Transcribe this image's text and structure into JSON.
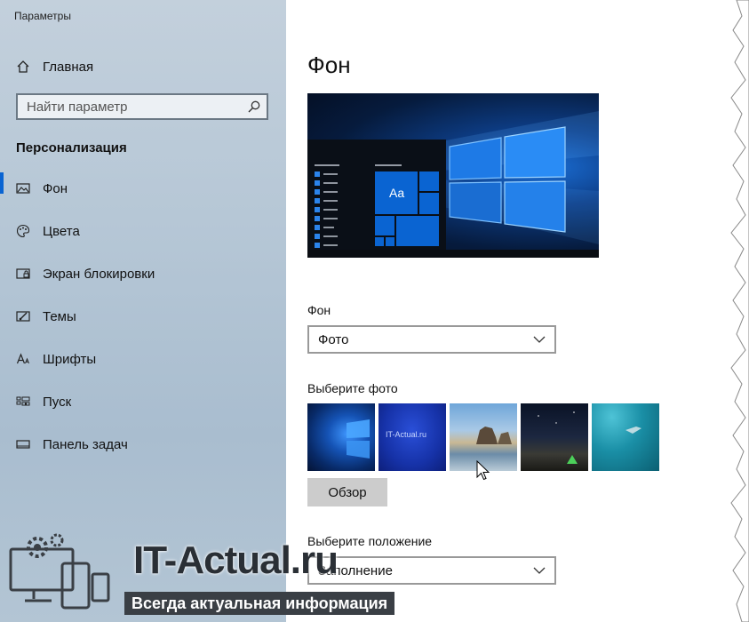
{
  "window": {
    "title": "Параметры"
  },
  "sidebar": {
    "home_label": "Главная",
    "search_placeholder": "Найти параметр",
    "section_title": "Персонализация",
    "items": [
      {
        "label": "Фон",
        "icon": "image-icon",
        "active": true
      },
      {
        "label": "Цвета",
        "icon": "palette-icon",
        "active": false
      },
      {
        "label": "Экран блокировки",
        "icon": "lock-screen-icon",
        "active": false
      },
      {
        "label": "Темы",
        "icon": "themes-icon",
        "active": false
      },
      {
        "label": "Шрифты",
        "icon": "fonts-icon",
        "active": false
      },
      {
        "label": "Пуск",
        "icon": "start-icon",
        "active": false
      },
      {
        "label": "Панель задач",
        "icon": "taskbar-icon",
        "active": false
      }
    ]
  },
  "main": {
    "title": "Фон",
    "preview": {
      "tile_text": "Aa"
    },
    "background_label": "Фон",
    "background_value": "Фото",
    "choose_photo_label": "Выберите фото",
    "thumb_2_caption": "IT-Actual.ru",
    "browse_label": "Обзор",
    "choose_fit_label": "Выберите положение",
    "fit_value": "Заполнение"
  },
  "watermark": {
    "logo": "IT-Actual.ru",
    "tagline": "Всегда актуальная информация"
  },
  "colors": {
    "accent": "#0a64d2",
    "sidebar_bg": "#b6c7d6",
    "tile_blue": "#0a64d2"
  }
}
